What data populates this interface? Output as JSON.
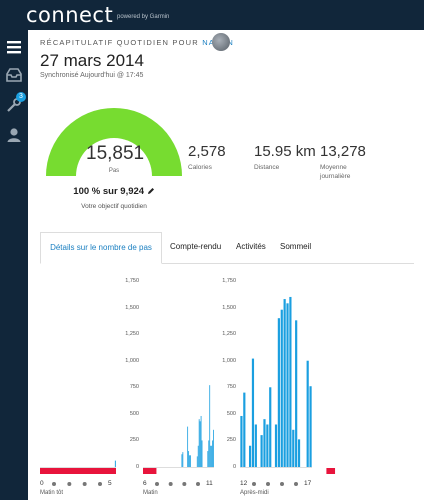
{
  "app": {
    "logo": "connect",
    "logo_sub": "powered by Garmin"
  },
  "sidebar": {
    "badge_count": "3"
  },
  "header": {
    "subtitle_prefix": "RÉCAPITULATIF QUOTIDIEN POUR",
    "user": "NAKAN",
    "date": "27 mars 2014",
    "sync": "Synchronisé Aujourd'hui @ 17:45"
  },
  "summary": {
    "steps": "15,851",
    "steps_unit": "Pas",
    "goal_text": "100 % sur 9,924",
    "goal_label": "Votre objectif quotidien",
    "goal_progress": 1.0,
    "gauge_color": "#77dc30",
    "stats": [
      {
        "value": "2,578",
        "label": "Calories"
      },
      {
        "value": "15.95 km",
        "label": "Distance"
      },
      {
        "value": "13,278",
        "label": "Moyenne journalière"
      }
    ]
  },
  "tabs": [
    {
      "label": "Détails sur le nombre de pas",
      "active": true
    },
    {
      "label": "Compte-rendu",
      "active": false
    },
    {
      "label": "Activités",
      "active": false
    },
    {
      "label": "Sommeil",
      "active": false
    }
  ],
  "chart_data": {
    "type": "bar",
    "bar_color": "#1a9fe0",
    "inactive_color": "#e8143c",
    "yticks": [
      0,
      250,
      500,
      750,
      1000,
      1250,
      1500,
      1750
    ],
    "ytick_labels": [
      "0",
      "250",
      "500",
      "750",
      "1,000",
      "1,250",
      "1,500",
      "1,750"
    ],
    "ylim": [
      0,
      1750
    ],
    "panels": [
      {
        "name": "Matin tôt",
        "x_start": "0",
        "x_end": "5",
        "values": [
          0,
          0,
          0,
          0,
          0,
          0,
          0,
          0,
          0,
          0,
          0,
          0,
          0,
          0,
          0,
          0,
          0,
          0,
          0,
          0,
          0,
          0,
          0,
          0,
          0,
          0,
          0,
          0,
          0,
          0,
          0,
          0,
          0,
          0,
          0,
          0,
          0,
          0,
          0,
          0,
          0,
          0,
          0,
          0,
          0,
          0,
          0,
          0,
          0,
          0,
          0,
          0,
          0,
          0,
          0,
          0,
          0,
          0,
          0,
          60
        ],
        "inactive": [
          [
            0,
            60
          ]
        ]
      },
      {
        "name": "Matin",
        "x_start": "6",
        "x_end": "11",
        "values": [
          0,
          0,
          0,
          0,
          0,
          0,
          0,
          0,
          0,
          0,
          0,
          0,
          0,
          0,
          0,
          0,
          0,
          0,
          0,
          0,
          0,
          0,
          0,
          0,
          0,
          0,
          0,
          0,
          0,
          0,
          0,
          0,
          0,
          0,
          0,
          0,
          0,
          0,
          0,
          0,
          120,
          140,
          0,
          0,
          0,
          0,
          380,
          150,
          110,
          110,
          0,
          0,
          0,
          0,
          0,
          0,
          100,
          200,
          450,
          430,
          480,
          250,
          0,
          0,
          0,
          0,
          0,
          150,
          250,
          770,
          200,
          200,
          250,
          350
        ],
        "inactive": [
          [
            0,
            14
          ]
        ]
      },
      {
        "name": "Après-midi",
        "x_start": "12",
        "x_end": "17",
        "values": [
          480,
          700,
          0,
          200,
          1020,
          400,
          0,
          300,
          450,
          400,
          750,
          0,
          400,
          1400,
          1480,
          1580,
          1540,
          1600,
          350,
          1380,
          260,
          0,
          0,
          1000,
          760
        ],
        "inactive": [
          [
            30,
            33
          ]
        ]
      }
    ]
  }
}
